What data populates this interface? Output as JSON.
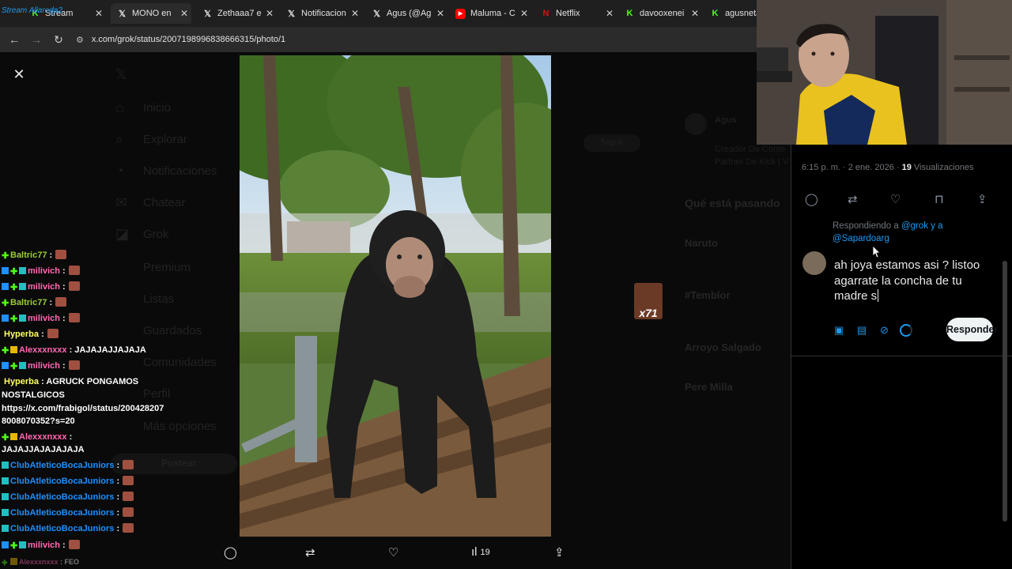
{
  "browser": {
    "tabs": [
      {
        "title": "Stream",
        "icon": "grok-x-icon",
        "extra": "Grok",
        "color": "#1f9bf0"
      },
      {
        "title": "MONO en",
        "icon": "x-icon",
        "extra": "",
        "color": "#ffffff"
      },
      {
        "title": "Zethaaa7 e",
        "icon": "x-icon",
        "extra": "",
        "color": "#ffffff"
      },
      {
        "title": "Notificacion",
        "icon": "x-icon",
        "extra": "",
        "color": "#ffffff"
      },
      {
        "title": "Agus (@Ag",
        "icon": "x-icon",
        "extra": "",
        "color": "#ffffff"
      },
      {
        "title": "Maluma - C",
        "icon": "youtube-icon",
        "extra": "",
        "color": "#ff0000"
      },
      {
        "title": "Netflix",
        "icon": "netflix-icon",
        "extra": "",
        "color": "#e50914"
      },
      {
        "title": "davooxenei",
        "icon": "kick-icon",
        "extra": "",
        "color": "#53fc18"
      },
      {
        "title": "agusneta",
        "icon": "kick-icon",
        "extra": "",
        "color": "#53fc18"
      }
    ],
    "overlay_text": "Stream Allareda2",
    "url": "x.com/grok/status/2007198996838666315/photo/1"
  },
  "ghost_nav": {
    "items": [
      "Inicio",
      "Explorar",
      "Notificaciones",
      "Chatear",
      "Grok",
      "Premium",
      "Listas",
      "Guardados",
      "Comunidades",
      "Perfil",
      "Más opciones"
    ],
    "post_button": "Postear",
    "right_heading": "Qué está pasando",
    "profile_name": "Agus",
    "profile_bio_1": "Creador De Conte",
    "profile_bio_2": "Partner De Kick | V",
    "trends": [
      "Naruto",
      "#Temblor",
      "Arroyo Salgado",
      "Pere Milla"
    ],
    "follow_label": "Seguir"
  },
  "photo": {
    "alt": "chimpanzee-on-bench-photo"
  },
  "photo_actions": {
    "views": "19"
  },
  "chat": [
    {
      "user": "Baltric77",
      "color": "#9acd32",
      "badges": [
        "green"
      ],
      "msg": "",
      "emote": true
    },
    {
      "user": "milivich",
      "color": "#ff69b4",
      "badges": [
        "blue",
        "green",
        "cyan"
      ],
      "msg": "",
      "emote": true
    },
    {
      "user": "milivich",
      "color": "#ff69b4",
      "badges": [
        "blue",
        "green",
        "cyan"
      ],
      "msg": "",
      "emote": true
    },
    {
      "user": "Baltric77",
      "color": "#9acd32",
      "badges": [
        "green"
      ],
      "msg": "",
      "emote": true
    },
    {
      "user": "milivich",
      "color": "#ff69b4",
      "badges": [
        "blue",
        "green",
        "cyan"
      ],
      "msg": "",
      "emote": true
    },
    {
      "user": "Hyperba",
      "color": "#ffff66",
      "badges": [],
      "msg": "",
      "emote": true
    },
    {
      "user": "Alexxxnxxx",
      "color": "#ff69b4",
      "badges": [
        "green",
        "yellow"
      ],
      "msg": "JAJAJAJJAJAJA",
      "emote": false
    },
    {
      "user": "milivich",
      "color": "#ff69b4",
      "badges": [
        "blue",
        "green",
        "cyan"
      ],
      "msg": "",
      "emote": true
    },
    {
      "user": "Hyperba",
      "color": "#ffff66",
      "badges": [],
      "msg": "AGRUCK PONGAMOS",
      "emote": false
    },
    {
      "user": "",
      "color": "#ffffff",
      "badges": [],
      "msg": "NOSTALGICOS",
      "emote": false
    },
    {
      "user": "",
      "color": "#ffffff",
      "badges": [],
      "msg": "https://x.com/frabigol/status/200428207",
      "emote": false
    },
    {
      "user": "",
      "color": "#ffffff",
      "badges": [],
      "msg": "8008070352?s=20",
      "emote": false
    },
    {
      "user": "Alexxxnxxx",
      "color": "#ff69b4",
      "badges": [
        "green",
        "yellow"
      ],
      "msg": "",
      "emote": false
    },
    {
      "user": "",
      "color": "#ffffff",
      "badges": [],
      "msg": "JAJAJJAJAJAJAJA",
      "emote": false
    },
    {
      "user": "ClubAtleticoBocaJuniors",
      "color": "#1e90ff",
      "badges": [
        "cyan"
      ],
      "msg": "",
      "emote": true
    },
    {
      "user": "ClubAtleticoBocaJuniors",
      "color": "#1e90ff",
      "badges": [
        "cyan"
      ],
      "msg": "",
      "emote": true
    },
    {
      "user": "ClubAtleticoBocaJuniors",
      "color": "#1e90ff",
      "badges": [
        "cyan"
      ],
      "msg": "",
      "emote": true
    },
    {
      "user": "ClubAtleticoBocaJuniors",
      "color": "#1e90ff",
      "badges": [
        "cyan"
      ],
      "msg": "",
      "emote": true
    },
    {
      "user": "ClubAtleticoBocaJuniors",
      "color": "#1e90ff",
      "badges": [
        "cyan"
      ],
      "msg": "",
      "emote": true
    },
    {
      "user": "milivich",
      "color": "#ff69b4",
      "badges": [
        "blue",
        "green",
        "cyan"
      ],
      "msg": "",
      "emote": true
    },
    {
      "user": "Alexxxnxxx",
      "color": "#ff69b4",
      "badges": [
        "green",
        "yellow"
      ],
      "msg": "FEO",
      "emote": false
    }
  ],
  "sticker": {
    "label": "x71"
  },
  "reply_panel": {
    "time": "6:15 p. m. · 2 ene. 2026 · ",
    "views_count": "19",
    "views_label": " Visualizaciones",
    "replying_prefix": "Respondiendo a ",
    "mention_1": "@grok",
    "replying_mid": " y a",
    "mention_2": "@Sapardoarg",
    "draft": "ah joya estamos asi ? listoo agarrate la concha de tu madre s",
    "reply_button": "Responder"
  }
}
